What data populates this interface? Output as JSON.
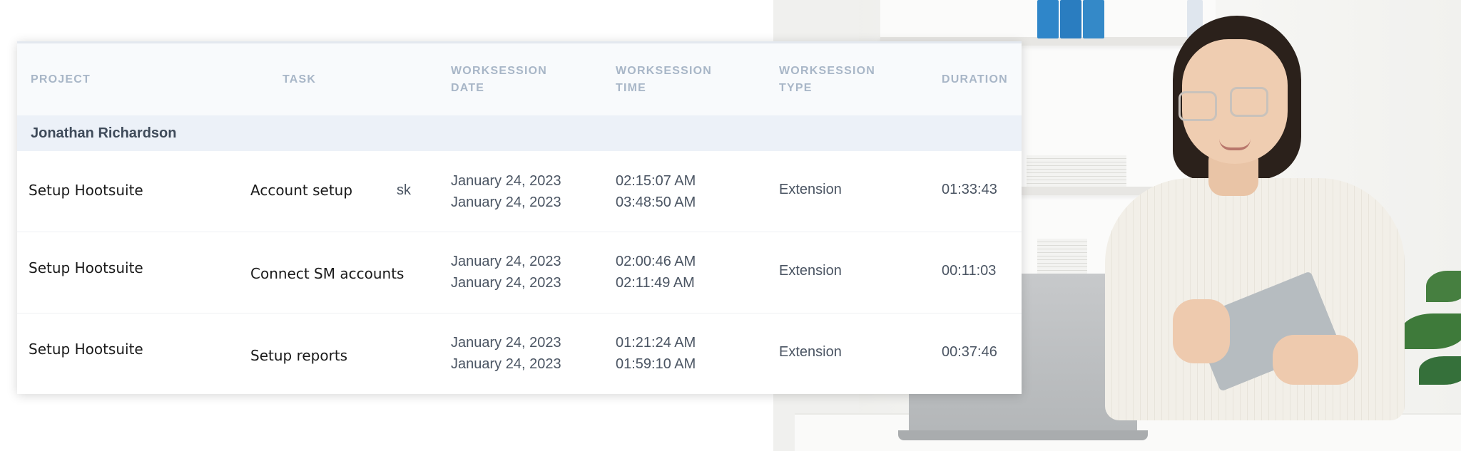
{
  "table": {
    "columns": {
      "project": "PROJECT",
      "task": "TASK",
      "date": "WORKSESSION\nDATE",
      "time": "WORKSESSION\nTIME",
      "type": "WORKSESSION\nTYPE",
      "duration": "DURATION"
    },
    "group": "Jonathan Richardson",
    "rows": [
      {
        "project": "Setup Hootsuite",
        "task": "Account setup",
        "task_overflow": "sk",
        "date_start": "January 24, 2023",
        "date_end": "January 24, 2023",
        "time_start": "02:15:07 AM",
        "time_end": "03:48:50 AM",
        "type": "Extension",
        "duration": "01:33:43"
      },
      {
        "project": "Setup Hootsuite",
        "task": "Connect SM accounts",
        "date_start": "January 24, 2023",
        "date_end": "January 24, 2023",
        "time_start": "02:00:46 AM",
        "time_end": "02:11:49 AM",
        "type": "Extension",
        "duration": "00:11:03"
      },
      {
        "project": "Setup Hootsuite",
        "task": "Setup reports",
        "date_start": "January 24, 2023",
        "date_end": "January 24, 2023",
        "time_start": "01:21:24 AM",
        "time_end": "01:59:10 AM",
        "type": "Extension",
        "duration": "00:37:46"
      }
    ]
  }
}
